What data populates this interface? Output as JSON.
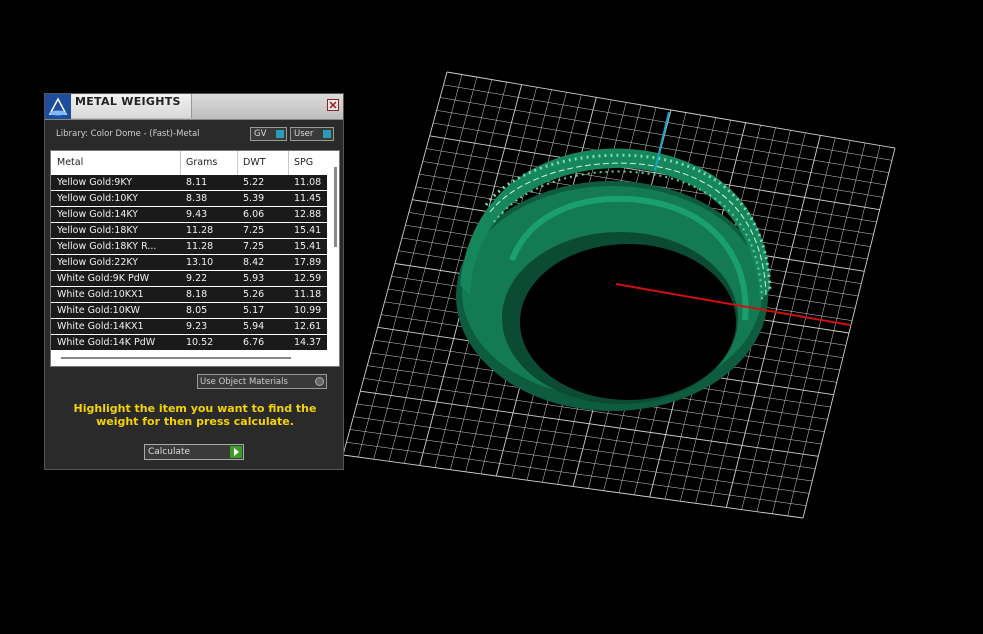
{
  "panel": {
    "title": "METAL WEIGHTS",
    "library": "Library: Color Dome - (Fast)-Metal",
    "toggle_gv": "GV",
    "toggle_user": "User",
    "columns": [
      "Metal",
      "Grams",
      "DWT",
      "SPG"
    ],
    "rows": [
      [
        "Yellow Gold:9KY",
        "8.11",
        "5.22",
        "11.08"
      ],
      [
        "Yellow Gold:10KY",
        "8.38",
        "5.39",
        "11.45"
      ],
      [
        "Yellow Gold:14KY",
        "9.43",
        "6.06",
        "12.88"
      ],
      [
        "Yellow Gold:18KY",
        "11.28",
        "7.25",
        "15.41"
      ],
      [
        "Yellow Gold:18KY R...",
        "11.28",
        "7.25",
        "15.41"
      ],
      [
        "Yellow Gold:22KY",
        "13.10",
        "8.42",
        "17.89"
      ],
      [
        "White Gold:9K PdW",
        "9.22",
        "5.93",
        "12.59"
      ],
      [
        "White Gold:10KX1",
        "8.18",
        "5.26",
        "11.18"
      ],
      [
        "White Gold:10KW",
        "8.05",
        "5.17",
        "10.99"
      ],
      [
        "White Gold:14KX1",
        "9.23",
        "5.94",
        "12.61"
      ],
      [
        "White Gold:14K PdW",
        "10.52",
        "6.76",
        "14.37"
      ]
    ],
    "use_object_materials": "Use Object Materials",
    "hint": "Highlight the item you want to find the weight for then press calculate.",
    "calculate_label": "Calculate"
  },
  "viewport": {
    "ring_color": "#0f6b4a",
    "grid_color": "#d0d0d0",
    "axis_x_color": "#d01010",
    "axis_z_color": "#19a5c2"
  }
}
